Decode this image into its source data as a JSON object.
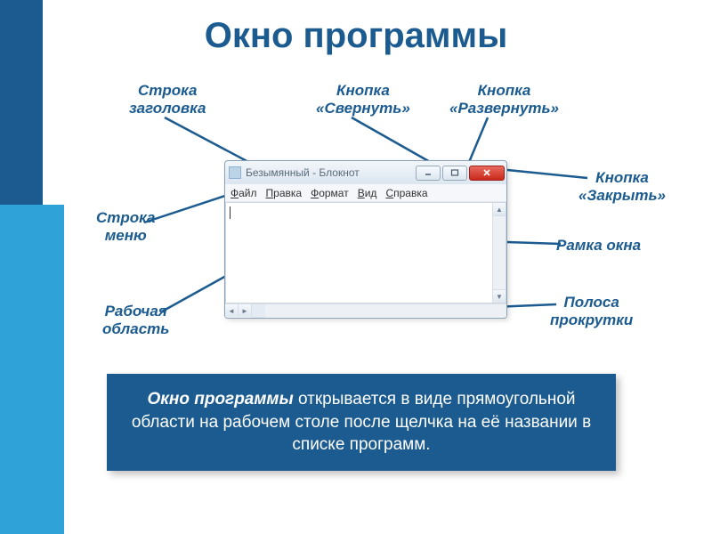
{
  "title": "Окно программы",
  "labels": {
    "titlebar": "Строка\nзаголовка",
    "minimize": "Кнопка\n«Свернуть»",
    "maximize": "Кнопка\n«Развернуть»",
    "close": "Кнопка\n«Закрыть»",
    "menubar": "Строка\nменю",
    "frame": "Рамка окна",
    "scrollbar": "Полоса\nпрокрутки",
    "workarea": "Рабочая\nобласть"
  },
  "window": {
    "title": "Безымянный - Блокнот",
    "menu": [
      "Файл",
      "Правка",
      "Формат",
      "Вид",
      "Справка"
    ]
  },
  "description": {
    "bold": "Окно программы",
    "rest": " открывается в виде прямоугольной области на рабочем столе после щелчка на её названии в списке программ."
  }
}
